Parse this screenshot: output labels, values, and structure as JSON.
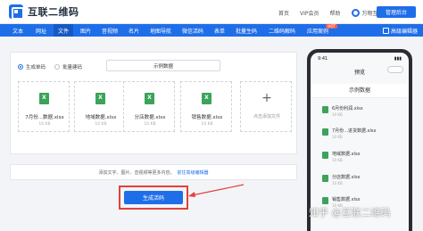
{
  "header": {
    "logo_text": "互联二维码",
    "nav": [
      "首页",
      "VIP会员",
      "帮助"
    ],
    "brand": "万物互联",
    "admin_button": "管理后台"
  },
  "navbar": {
    "items": [
      "文本",
      "网址",
      "文件",
      "图片",
      "音视频",
      "名片",
      "地图导航",
      "微信活码",
      "表单",
      "批量生码",
      "二维码解码",
      "应用案例"
    ],
    "active": "文件",
    "hot_badge": "HOT",
    "advanced": "高级编辑器"
  },
  "editor": {
    "radio_single": "生成单码",
    "radio_batch": "批量建码",
    "name_value": "示例数据",
    "files": [
      {
        "name": "7月份...数据.xlsx",
        "size": "10 KB"
      },
      {
        "name": "地域数据.xlsx",
        "size": "10 KB"
      },
      {
        "name": "分店数据.xlsx",
        "size": "10 KB"
      },
      {
        "name": "销售数据.xlsx",
        "size": "10 KB"
      }
    ],
    "add_label": "点击添加文件",
    "hint_text": "添加文字、图片、音视频等更多内容，",
    "hint_link": "前往高级编辑器",
    "generate_button": "生成活码"
  },
  "preview": {
    "time": "9:41",
    "title": "预览",
    "name": "示例数据",
    "files": [
      {
        "name": "6月份利润.xlsx",
        "size": "10 KB"
      },
      {
        "name": "7月份...进货数据.xlsx",
        "size": "10 KB"
      },
      {
        "name": "地域数据.xlsx",
        "size": "10 KB"
      },
      {
        "name": "分店数据.xlsx",
        "size": "10 KB"
      },
      {
        "name": "销售数据.xlsx",
        "size": "10 KB"
      }
    ]
  },
  "watermark": "知乎 @互联二维码",
  "colors": {
    "primary": "#1f6ee9",
    "highlight": "#e2413b",
    "excel": "#3ca35b"
  }
}
